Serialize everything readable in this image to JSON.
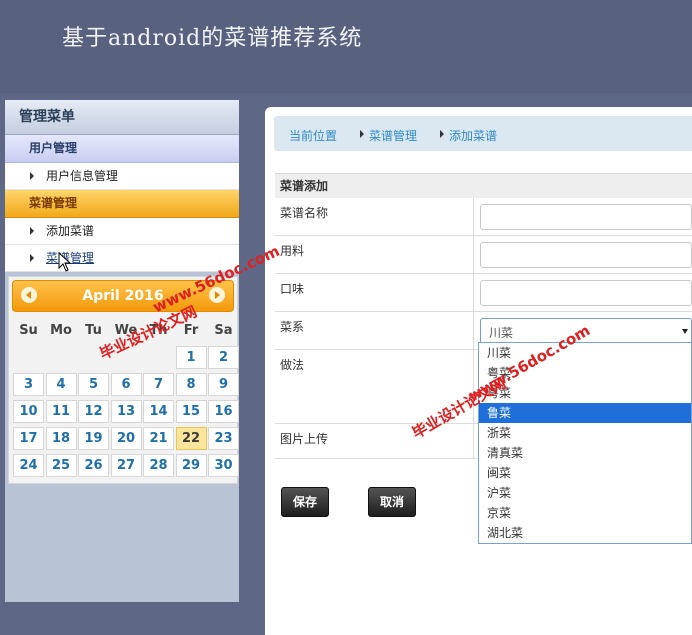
{
  "header": {
    "title": "基于android的菜谱推荐系统"
  },
  "sidebar": {
    "title": "管理菜单",
    "groups": [
      {
        "label": "用户管理",
        "items": [
          "用户信息管理"
        ]
      },
      {
        "label": "菜谱管理",
        "items": [
          "添加菜谱",
          "菜谱管理"
        ]
      }
    ]
  },
  "calendar": {
    "title": "April 2016",
    "weekdays": [
      "Su",
      "Mo",
      "Tu",
      "We",
      "Th",
      "Fr",
      "Sa"
    ],
    "leading_blanks": 5,
    "days": 30,
    "today": 22
  },
  "breadcrumb": [
    "当前位置",
    "菜谱管理",
    "添加菜谱"
  ],
  "form": {
    "title": "菜谱添加",
    "fields": [
      "菜谱名称",
      "用料",
      "口味",
      "菜系",
      "做法",
      "图片上传"
    ],
    "cuisine_selected": "川菜"
  },
  "dropdown": {
    "options": [
      "川菜",
      "粤菜",
      "粤菜",
      "鲁菜",
      "浙菜",
      "清真菜",
      "闽菜",
      "沪菜",
      "京菜",
      "湖北菜"
    ],
    "selected_index": 3
  },
  "buttons": {
    "save": "保存",
    "cancel": "取消"
  },
  "watermarks": [
    "www.56doc.com",
    "毕业设计论文网",
    "www.56doc.com",
    "毕业设计论文网"
  ],
  "colors": {
    "header_bg": "#58627f",
    "accent_orange": "#f39a0c",
    "link_blue": "#2f8bc5",
    "select_blue": "#1e6fd9"
  }
}
